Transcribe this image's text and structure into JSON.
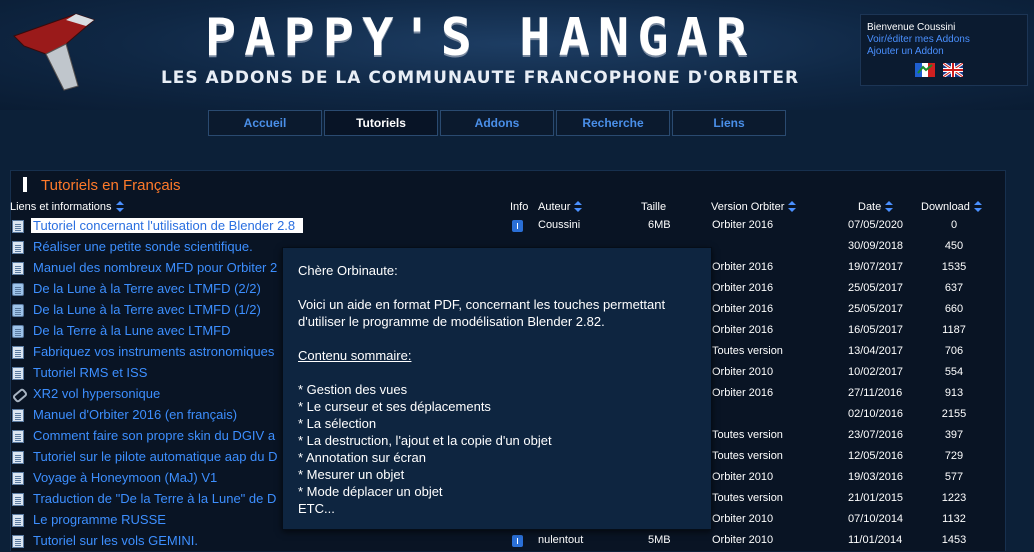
{
  "header": {
    "title": "PAPPY'S HANGAR",
    "subtitle": "LES ADDONS DE LA COMMUNAUTE FRANCOPHONE D'ORBITER",
    "logo_icon": "spaceship-icon"
  },
  "user_box": {
    "welcome": "Bienvenue Coussini",
    "edit_link": "Voir/éditer mes Addons",
    "add_link": "Ajouter un Addon",
    "flags": [
      "flag-fr-icon",
      "flag-uk-icon"
    ]
  },
  "nav": {
    "tabs": [
      {
        "label": "Accueil",
        "active": false
      },
      {
        "label": "Tutoriels",
        "active": true
      },
      {
        "label": "Addons",
        "active": false
      },
      {
        "label": "Recherche",
        "active": false
      },
      {
        "label": "Liens",
        "active": false
      }
    ]
  },
  "section": {
    "title": "Tutoriels en Français"
  },
  "table": {
    "headers": {
      "links": "Liens et informations",
      "info": "Info",
      "author": "Auteur",
      "size": "Taille",
      "version": "Version Orbiter",
      "date": "Date",
      "download": "Download"
    },
    "rows": [
      {
        "icon": "document-icon",
        "title": "Tutoriel concernant l'utilisation de Blender 2.8",
        "selected": true,
        "author": "Coussini",
        "size": "6MB",
        "version": "Orbiter 2016",
        "date": "07/05/2020",
        "downloads": "0"
      },
      {
        "icon": "document-icon",
        "title": "Réaliser une petite sonde scientifique.",
        "author": "",
        "size": "",
        "version": "",
        "date": "30/09/2018",
        "downloads": "450"
      },
      {
        "icon": "document-icon",
        "title": "Manuel des nombreux MFD pour Orbiter 2",
        "author": "",
        "size": "",
        "version": "Orbiter 2016",
        "date": "19/07/2017",
        "downloads": "1535"
      },
      {
        "icon": "globe-document-icon",
        "title": "De la Lune à la Terre avec LTMFD (2/2)",
        "author": "",
        "size": "",
        "version": "Orbiter 2016",
        "date": "25/05/2017",
        "downloads": "637"
      },
      {
        "icon": "globe-document-icon",
        "title": "De la Lune à la Terre avec LTMFD (1/2)",
        "author": "",
        "size": "",
        "version": "Orbiter 2016",
        "date": "25/05/2017",
        "downloads": "660"
      },
      {
        "icon": "globe-document-icon",
        "title": "De la Terre à la Lune avec LTMFD",
        "author": "",
        "size": "",
        "version": "Orbiter 2016",
        "date": "16/05/2017",
        "downloads": "1187"
      },
      {
        "icon": "document-icon",
        "title": "Fabriquez vos instruments astronomiques",
        "author": "",
        "size": "",
        "version": "Toutes version",
        "date": "13/04/2017",
        "downloads": "706"
      },
      {
        "icon": "document-icon",
        "title": "Tutoriel RMS et ISS",
        "author": "",
        "size": "",
        "version": "Orbiter 2010",
        "date": "10/02/2017",
        "downloads": "554"
      },
      {
        "icon": "link-icon",
        "title": "XR2 vol hypersonique",
        "author": "",
        "size": "",
        "version": "Orbiter 2016",
        "date": "27/11/2016",
        "downloads": "913"
      },
      {
        "icon": "document-icon",
        "title": "Manuel d'Orbiter 2016 (en français)",
        "author": "",
        "size": "",
        "version": "",
        "date": "02/10/2016",
        "downloads": "2155"
      },
      {
        "icon": "document-icon",
        "title": "Comment faire son propre skin du DGIV a",
        "author": "",
        "size": "",
        "version": "Toutes version",
        "date": "23/07/2016",
        "downloads": "397"
      },
      {
        "icon": "document-icon",
        "title": "Tutoriel sur le pilote automatique aap du D",
        "author": "",
        "size": "",
        "version": "Toutes version",
        "date": "12/05/2016",
        "downloads": "729"
      },
      {
        "icon": "document-icon",
        "title": "Voyage à Honeymoon (MaJ) V1",
        "author": "",
        "size": "",
        "version": "Orbiter 2010",
        "date": "19/03/2016",
        "downloads": "577"
      },
      {
        "icon": "document-icon",
        "title": "Traduction de \"De la Terre à la Lune\" de D",
        "author": "",
        "size": "",
        "version": "Toutes version",
        "date": "21/01/2015",
        "downloads": "1223"
      },
      {
        "icon": "document-icon",
        "title": "Le programme RUSSE",
        "author": "",
        "size": "",
        "version": "Orbiter 2010",
        "date": "07/10/2014",
        "downloads": "1132"
      },
      {
        "icon": "document-icon",
        "title": "Tutoriel sur les vols GEMINI.",
        "author": "nulentout",
        "size": "5MB",
        "version": "Orbiter 2010",
        "date": "11/01/2014",
        "downloads": "1453"
      }
    ]
  },
  "tooltip": {
    "greeting": "Chère Orbinaute:",
    "description": "Voici un aide en format PDF, concernant les touches permettant d'utiliser le programme de modélisation Blender 2.82.",
    "summary_heading": "Contenu sommaire:",
    "items": [
      "* Gestion des vues",
      "* Le curseur et ses déplacements",
      "* La sélection",
      "* La destruction, l'ajout et la copie d'un objet",
      "* Annotation sur écran",
      "* Mesurer un objet",
      "* Mode déplacer un objet",
      "ETC..."
    ]
  },
  "colors": {
    "background": "#0c2038",
    "link": "#3d8fff",
    "section_title": "#ff7a2a",
    "tooltip_bg": "#0e2540"
  }
}
